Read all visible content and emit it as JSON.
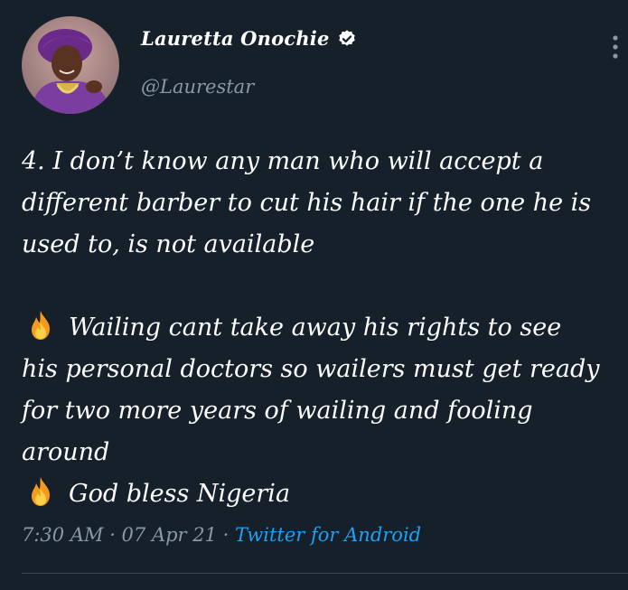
{
  "user": {
    "name": "Lauretta Onochie",
    "handle": "@Laurestar",
    "verified": true
  },
  "tweet": {
    "paragraph1": [
      "4. I don’t know any man who will accept a",
      "different barber to cut his hair if the one he is",
      "used to, is not available"
    ],
    "paragraph2": [
      "Wailing cant take away his rights to see",
      "his personal doctors so wailers must get ready",
      "for two more years of wailing and fooling",
      "around"
    ],
    "paragraph3": "God bless Nigeria",
    "emoji": "fire-emoji"
  },
  "meta": {
    "time": "7:30 AM",
    "separator1": " · ",
    "date": "07 Apr 21",
    "separator2": " · ",
    "source": "Twitter for Android"
  },
  "colors": {
    "background": "#15202b",
    "text": "#ffffff",
    "muted": "#8899a6",
    "link": "#1da1f2",
    "divider": "#38444d"
  }
}
